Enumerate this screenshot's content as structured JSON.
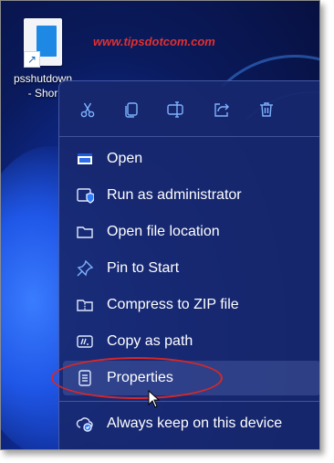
{
  "desktop": {
    "shortcut_label": "psshutdown\n- Shor",
    "watermark": "www.tipsdotcom.com"
  },
  "toolbar": {
    "buttons": [
      {
        "name": "cut",
        "icon": "scissors-icon"
      },
      {
        "name": "copy",
        "icon": "copy-icon"
      },
      {
        "name": "rename",
        "icon": "rename-icon"
      },
      {
        "name": "share",
        "icon": "share-icon"
      },
      {
        "name": "delete",
        "icon": "trash-icon"
      }
    ]
  },
  "menu": {
    "items": [
      {
        "label": "Open",
        "icon": "window-icon"
      },
      {
        "label": "Run as administrator",
        "icon": "shield-icon"
      },
      {
        "label": "Open file location",
        "icon": "folder-icon"
      },
      {
        "label": "Pin to Start",
        "icon": "pin-icon"
      },
      {
        "label": "Compress to ZIP file",
        "icon": "zip-folder-icon"
      },
      {
        "label": "Copy as path",
        "icon": "path-icon"
      },
      {
        "label": "Properties",
        "icon": "properties-icon",
        "highlighted": true
      },
      {
        "label": "Always keep on this device",
        "icon": "cloud-sync-icon"
      }
    ]
  },
  "colors": {
    "menu_bg": "#18286e",
    "icon_accent": "#7fb2ff",
    "annotation_red": "#d62828",
    "watermark_red": "#e03030"
  }
}
